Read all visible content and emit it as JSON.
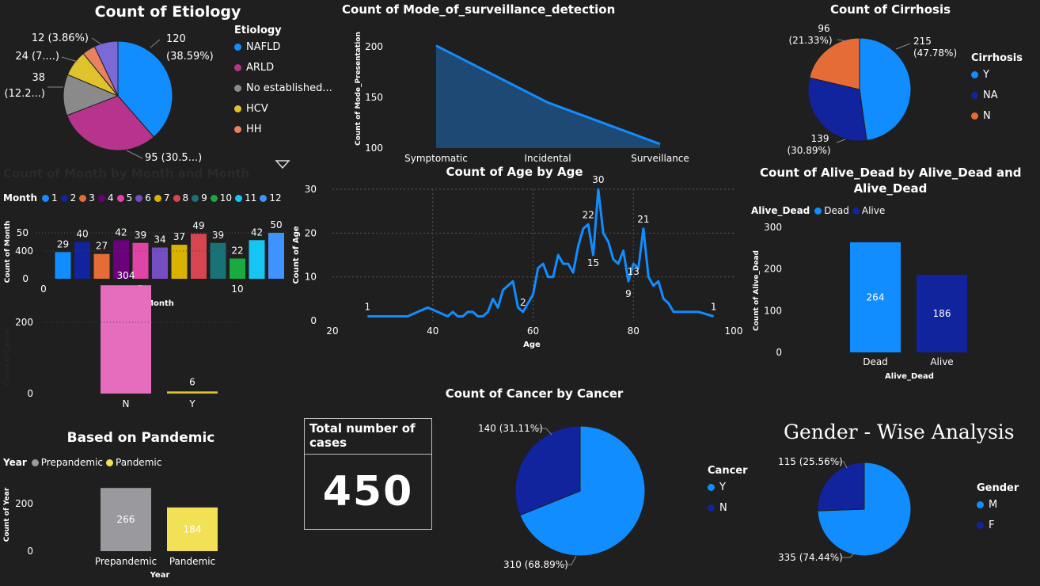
{
  "etiology": {
    "title": "Count of Etiology",
    "legend_title": "Etiology",
    "labels": [
      "120",
      "(38.59%)",
      "95 (30.5...)",
      "38",
      "(12.2...)",
      "24 (7....)",
      "12 (3.86%)"
    ],
    "chart_data": {
      "type": "pie",
      "categories": [
        "NAFLD",
        "ARLD",
        "No established...",
        "HCV",
        "HH"
      ],
      "values": [
        120,
        95,
        38,
        24,
        12,
        22
      ],
      "colors": [
        "#118DFF",
        "#B6348C",
        "#8A8A8A",
        "#E0C12E",
        "#E8825F",
        "#7B6AD6",
        "#E0636A"
      ]
    }
  },
  "mode": {
    "title": "Count of Mode_of_surveillance_detection",
    "ylabel": "Count of Mode_Presentation",
    "chart_data": {
      "type": "area",
      "categories": [
        "Symptomatic",
        "Incidental",
        "Surveillance"
      ],
      "values": [
        201,
        145,
        104
      ],
      "yticks": [
        100,
        150,
        200
      ],
      "ylim": [
        100,
        210
      ]
    }
  },
  "cirrhosis": {
    "title": "Count of Cirrhosis",
    "legend_title": "Cirrhosis",
    "labels": [
      "215",
      "(47.78%)",
      "139",
      "(30.89%)",
      "96",
      "(21.33%)"
    ],
    "chart_data": {
      "type": "pie",
      "categories": [
        "Y",
        "NA",
        "N"
      ],
      "values": [
        215,
        139,
        96
      ],
      "colors": [
        "#118DFF",
        "#12239E",
        "#E66C37"
      ]
    }
  },
  "month": {
    "title": "Count of Month by Month and Month",
    "legend_title": "Month",
    "ylabel": "Count of Month",
    "xlabel": "Month",
    "chart_data": {
      "type": "bar",
      "categories": [
        "1",
        "2",
        "3",
        "4",
        "5",
        "6",
        "7",
        "8",
        "9",
        "10",
        "11",
        "12"
      ],
      "values": [
        29,
        40,
        27,
        42,
        39,
        34,
        37,
        49,
        39,
        22,
        42,
        50
      ],
      "colors": [
        "#118DFF",
        "#12239E",
        "#E66C37",
        "#6B007B",
        "#E044A7",
        "#744EC2",
        "#D9B300",
        "#D64550",
        "#197278",
        "#1AAB40",
        "#15C6F4",
        "#4092FF"
      ],
      "xticks": [
        "0",
        "5",
        "10"
      ],
      "yticks": [
        "0",
        "50"
      ]
    }
  },
  "cancer_bar": {
    "ylabel": "Count of Cancer",
    "chart_data": {
      "type": "bar",
      "categories": [
        "N",
        "Y"
      ],
      "values": [
        304,
        6
      ],
      "colors": [
        "#E66CBE",
        "#E0C12E"
      ],
      "yticks": [
        "0",
        "200",
        "400"
      ]
    }
  },
  "age": {
    "title": "Count of Age by Age",
    "xlabel": "Age",
    "ylabel": "Count of Age",
    "chart_data": {
      "type": "line",
      "x": [
        27,
        30,
        35,
        37,
        39,
        41,
        43,
        44,
        45,
        46,
        47,
        48,
        49,
        50,
        51,
        52,
        53,
        54,
        55,
        56,
        57,
        58,
        59,
        60,
        61,
        62,
        63,
        64,
        65,
        66,
        67,
        68,
        69,
        70,
        71,
        72,
        73,
        74,
        75,
        76,
        77,
        78,
        79,
        80,
        81,
        82,
        83,
        84,
        85,
        86,
        87,
        88,
        89,
        90,
        91,
        93,
        96
      ],
      "y": [
        1,
        1,
        1,
        2,
        3,
        2,
        1,
        2,
        1,
        1,
        2,
        2,
        1,
        1,
        2,
        5,
        3,
        7,
        8,
        9,
        3,
        2,
        4,
        6,
        12,
        13,
        10,
        10,
        15,
        13,
        13,
        11,
        17,
        21,
        22,
        15,
        30,
        20,
        18,
        14,
        13,
        16,
        9,
        13,
        12,
        21,
        10,
        8,
        9,
        5,
        4,
        2,
        2,
        2,
        2,
        2,
        1
      ],
      "point_labels": [
        {
          "text": "1",
          "x": 27,
          "y": 1
        },
        {
          "text": "2",
          "x": 58,
          "y": 2
        },
        {
          "text": "22",
          "x": 71,
          "y": 22
        },
        {
          "text": "15",
          "x": 72,
          "y": 15
        },
        {
          "text": "30",
          "x": 73,
          "y": 30
        },
        {
          "text": "13",
          "x": 80,
          "y": 13
        },
        {
          "text": "9",
          "x": 79,
          "y": 9
        },
        {
          "text": "21",
          "x": 82,
          "y": 21
        },
        {
          "text": "1",
          "x": 96,
          "y": 1
        }
      ],
      "xticks": [
        20,
        40,
        60,
        80,
        100
      ],
      "yticks": [
        0,
        10,
        20,
        30
      ],
      "xlim": [
        20,
        100
      ],
      "ylim": [
        0,
        30
      ]
    }
  },
  "alive": {
    "title_line1": "Count of Alive_Dead by Alive_Dead and",
    "title_line2": "Alive_Dead",
    "legend_title": "Alive_Dead",
    "ylabel": "Count of Alive_Dead",
    "xlabel": "Alive_Dead",
    "chart_data": {
      "type": "bar",
      "categories": [
        "Dead",
        "Alive"
      ],
      "values": [
        264,
        186
      ],
      "colors": [
        "#118DFF",
        "#12239E"
      ],
      "yticks": [
        "0",
        "100",
        "200",
        "300"
      ]
    }
  },
  "pandemic": {
    "title": "Based on Pandemic",
    "legend_title": "Year",
    "ylabel": "Count of Year",
    "xlabel": "Year",
    "chart_data": {
      "type": "bar",
      "categories": [
        "Prepandemic",
        "Pandemic"
      ],
      "values": [
        266,
        184
      ],
      "colors": [
        "#9A9A9E",
        "#F2E055"
      ],
      "yticks": [
        "0",
        "200"
      ]
    }
  },
  "total": {
    "title": "Total number of cases",
    "value": "450"
  },
  "cancer_pie": {
    "title": "Count of Cancer by Cancer",
    "legend_title": "Cancer",
    "labels": [
      "140 (31.11%)",
      "310 (68.89%)"
    ],
    "chart_data": {
      "type": "pie",
      "categories": [
        "Y",
        "N"
      ],
      "values": [
        310,
        140
      ],
      "colors": [
        "#118DFF",
        "#12239E"
      ]
    }
  },
  "gender": {
    "title": "Gender - Wise Analysis",
    "legend_title": "Gender",
    "labels": [
      "115 (25.56%)",
      "335 (74.44%)"
    ],
    "chart_data": {
      "type": "pie",
      "categories": [
        "M",
        "F"
      ],
      "values": [
        335,
        115
      ],
      "colors": [
        "#118DFF",
        "#12239E"
      ]
    }
  }
}
